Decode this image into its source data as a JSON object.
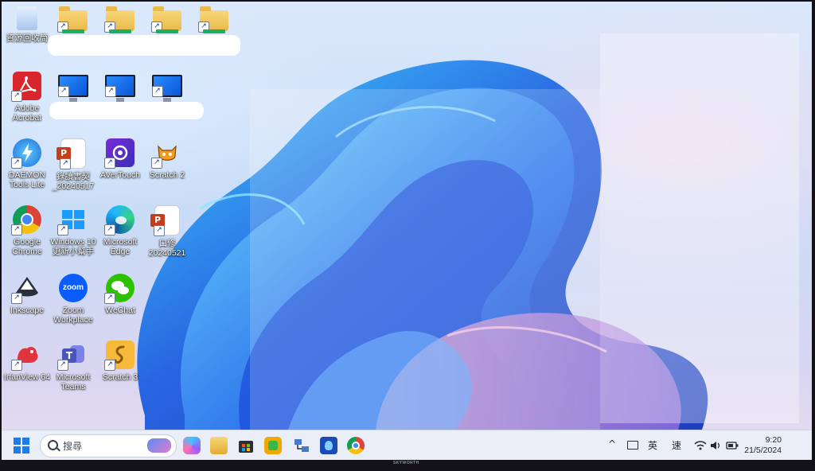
{
  "desktop": {
    "row1": [
      {
        "label": "資源回收筒",
        "icon": "recycle-bin-icon"
      },
      {
        "label": "",
        "icon": "folder-icon"
      },
      {
        "label": "",
        "icon": "folder-icon"
      },
      {
        "label": "",
        "icon": "folder-icon"
      },
      {
        "label": "",
        "icon": "folder-icon"
      }
    ],
    "row2": [
      {
        "label": "Adobe Acrobat",
        "icon": "adobe-acrobat-icon"
      },
      {
        "label": "",
        "icon": "monitor-icon"
      },
      {
        "label": "",
        "icon": "monitor-icon"
      },
      {
        "label": "",
        "icon": "monitor-icon"
      }
    ],
    "row3": [
      {
        "label": "DAEMON Tools Lite",
        "icon": "daemon-tools-icon"
      },
      {
        "label": "錄讀書契 _20240517",
        "icon": "powerpoint-file-icon"
      },
      {
        "label": "AVerTouch",
        "icon": "avertouch-icon"
      },
      {
        "label": "Scratch 2",
        "icon": "scratch-cat-icon"
      }
    ],
    "row4": [
      {
        "label": "Google Chrome",
        "icon": "chrome-icon"
      },
      {
        "label": "Windows 10 更新小幫手",
        "icon": "windows-update-icon"
      },
      {
        "label": "Microsoft Edge",
        "icon": "edge-icon"
      },
      {
        "label": "口修 20240521",
        "icon": "powerpoint-file-icon"
      }
    ],
    "row5": [
      {
        "label": "Inkscape",
        "icon": "inkscape-icon"
      },
      {
        "label": "Zoom Workplace",
        "icon": "zoom-icon"
      },
      {
        "label": "WeChat",
        "icon": "wechat-icon"
      }
    ],
    "row6": [
      {
        "label": "IrfanView 64",
        "icon": "irfanview-icon"
      },
      {
        "label": "Microsoft Teams",
        "icon": "teams-icon"
      },
      {
        "label": "Scratch 3",
        "icon": "scratch3-icon"
      }
    ]
  },
  "taskbar": {
    "search_placeholder": "搜尋",
    "tray": {
      "lang1": "英",
      "lang2": "速",
      "time": "9:20",
      "date": "21/5/2024"
    }
  },
  "monitor_brand": "SKYWORTH",
  "colors": {
    "accent": "#1f5fe0",
    "taskbar_bg": "#e9eef7"
  }
}
